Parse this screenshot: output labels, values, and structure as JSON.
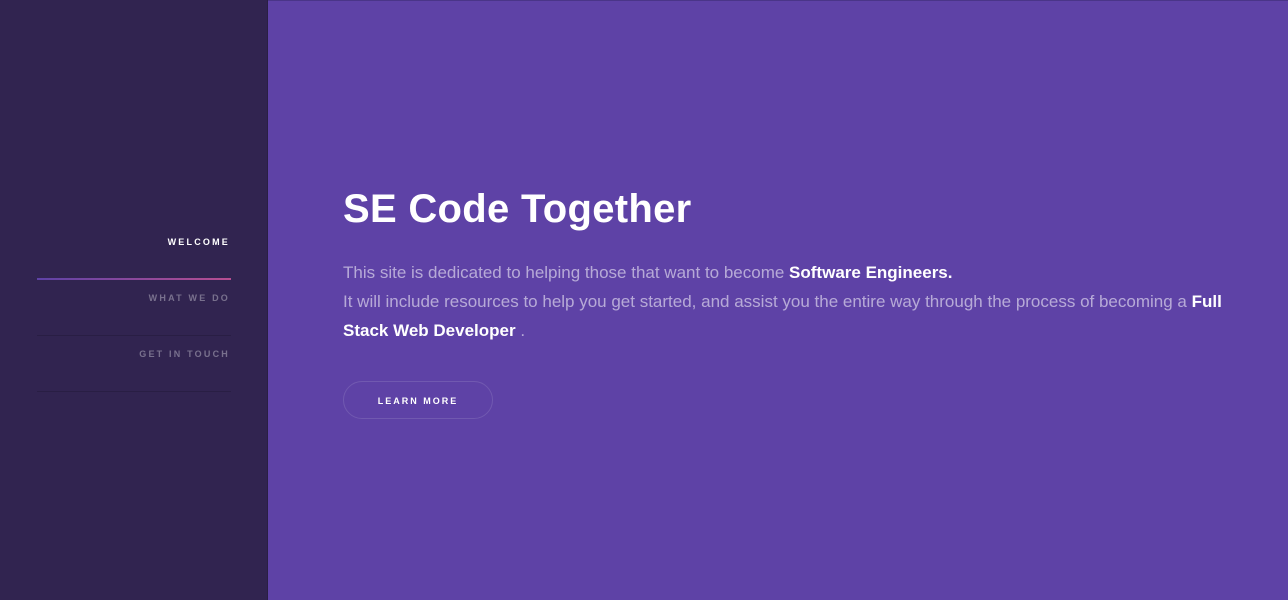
{
  "sidebar": {
    "nav": [
      {
        "label": "Welcome",
        "active": true
      },
      {
        "label": "What We Do",
        "active": false
      },
      {
        "label": "Get In Touch",
        "active": false
      }
    ]
  },
  "hero": {
    "title": "SE Code Together",
    "desc_line1_prefix": "This site is dedicated to helping those that want to become ",
    "desc_line1_bold": "Software Engineers.",
    "desc_line2": "It will include resources to help you get started, and assist you the entire way through the process of becoming a ",
    "desc_line2_bold": "Full Stack Web Developer",
    "desc_line2_suffix": " .",
    "button_label": "Learn More"
  },
  "colors": {
    "sidebar_bg": "#312450",
    "main_bg": "#5e42a6",
    "accent_gradient_start": "#5e42a6",
    "accent_gradient_end": "#b74e91"
  }
}
